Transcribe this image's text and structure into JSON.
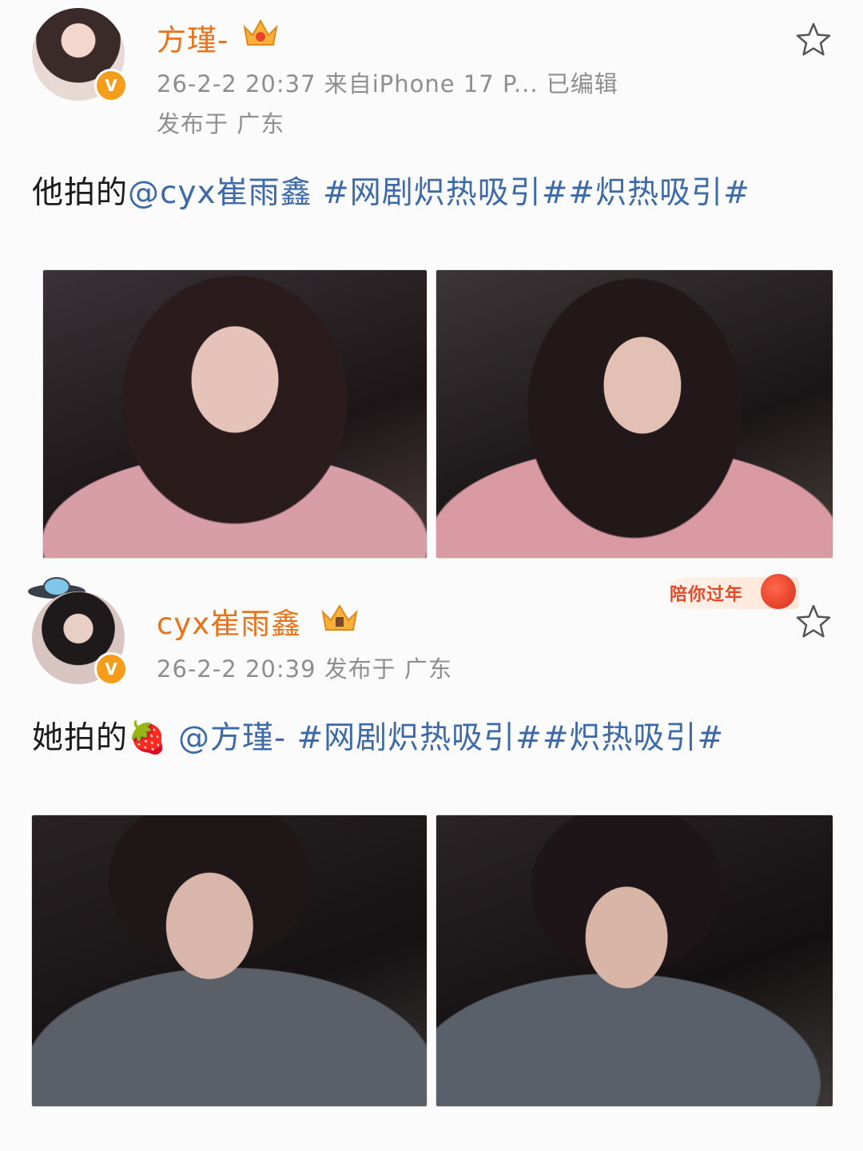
{
  "post1": {
    "username": "方瑾-",
    "meta_line1": "26-2-2 20:37  来自iPhone 17 P...  已编辑",
    "meta_line2": "发布于 广东",
    "content": {
      "prefix": "他拍的",
      "mention": "@cyx崔雨鑫",
      "tags": "#网剧炽热吸引##炽热吸引#"
    },
    "verified_badge": "V"
  },
  "post2": {
    "username": "cyx崔雨鑫",
    "meta": "26-2-2 20:39  发布于 广东",
    "banner": "陪你过年",
    "content": {
      "prefix": "她拍的",
      "emoji": "🍓",
      "mention": "@方瑾-",
      "tags": "#网剧炽热吸引##炽热吸引#"
    },
    "verified_badge": "V"
  },
  "colors": {
    "username": "#e8731a",
    "link": "#3d6aa8",
    "meta": "#8e8e8e",
    "badge": "#f59c1a"
  }
}
